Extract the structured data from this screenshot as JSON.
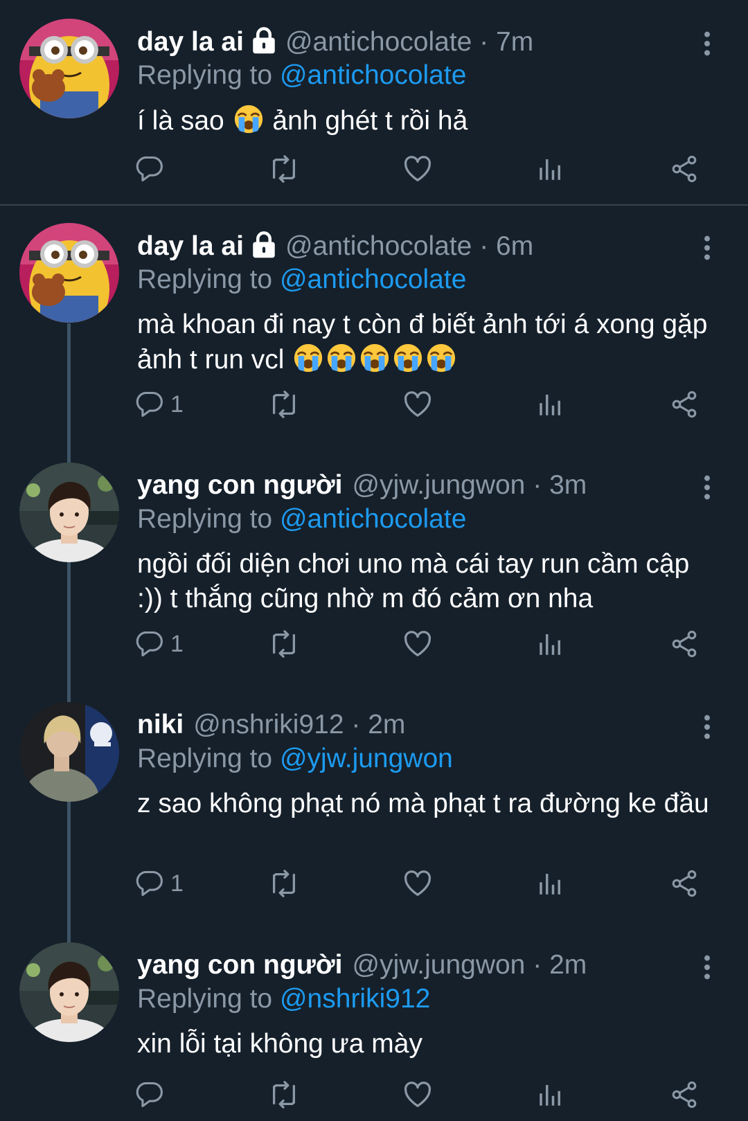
{
  "tweets": [
    {
      "name": "day la ai",
      "handle": "@antichocolate",
      "dot": "·",
      "time": "7m",
      "replying_prefix": "Replying to",
      "replying_to": "@antichocolate",
      "text_before": "í là sao ",
      "text_after": " ảnh ghét t rồi hả",
      "reply_count": ""
    },
    {
      "name": "day la ai",
      "handle": "@antichocolate",
      "dot": "·",
      "time": "6m",
      "replying_prefix": "Replying to",
      "replying_to": "@antichocolate",
      "text_before": "mà khoan đi nay t còn đ biết ảnh tới á xong gặp ảnh t run vcl ",
      "text_after": "",
      "reply_count": "1"
    },
    {
      "name": "yang con người",
      "handle": "@yjw.jungwon",
      "dot": "·",
      "time": "3m",
      "replying_prefix": "Replying to",
      "replying_to": "@antichocolate",
      "text": "ngồi đối diện chơi uno mà cái tay run cầm cập :)) t thắng cũng nhờ m đó cảm ơn nha",
      "reply_count": "1"
    },
    {
      "name": "niki",
      "handle": "@nshriki912",
      "dot": "·",
      "time": "2m",
      "replying_prefix": "Replying to",
      "replying_to": "@yjw.jungwon",
      "text": "z sao không phạt nó mà phạt t ra đường ke đầu",
      "reply_count": "1"
    },
    {
      "name": "yang con người",
      "handle": "@yjw.jungwon",
      "dot": "·",
      "time": "2m",
      "replying_prefix": "Replying to",
      "replying_to": "@nshriki912",
      "text": "xin lỗi tại không ưa mày",
      "reply_count": ""
    }
  ],
  "icons": {
    "reply": "reply-icon",
    "retweet": "retweet-icon",
    "like": "heart-icon",
    "views": "views-icon",
    "share": "share-icon",
    "more": "more-vertical-icon",
    "lock": "lock-icon",
    "emoji": "loudly-crying-face-emoji"
  },
  "colors": {
    "background": "#15202b",
    "secondary_text": "#8b98a5",
    "link": "#1d9bf0",
    "thread_line": "#3d5466"
  }
}
